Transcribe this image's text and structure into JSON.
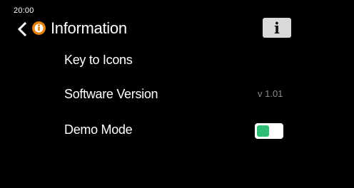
{
  "status_bar": {
    "time": "20:00"
  },
  "header": {
    "title": "Information",
    "back_icon": "chevron-left-icon",
    "badge_icon": "info-circle-icon",
    "badge_color": "#e8820e",
    "info_button_label": "i"
  },
  "menu": {
    "items": [
      {
        "label": "Key to Icons"
      },
      {
        "label": "Software Version",
        "value": "v 1.01"
      },
      {
        "label": "Demo Mode",
        "toggle_color": "#2fbd73"
      }
    ]
  }
}
